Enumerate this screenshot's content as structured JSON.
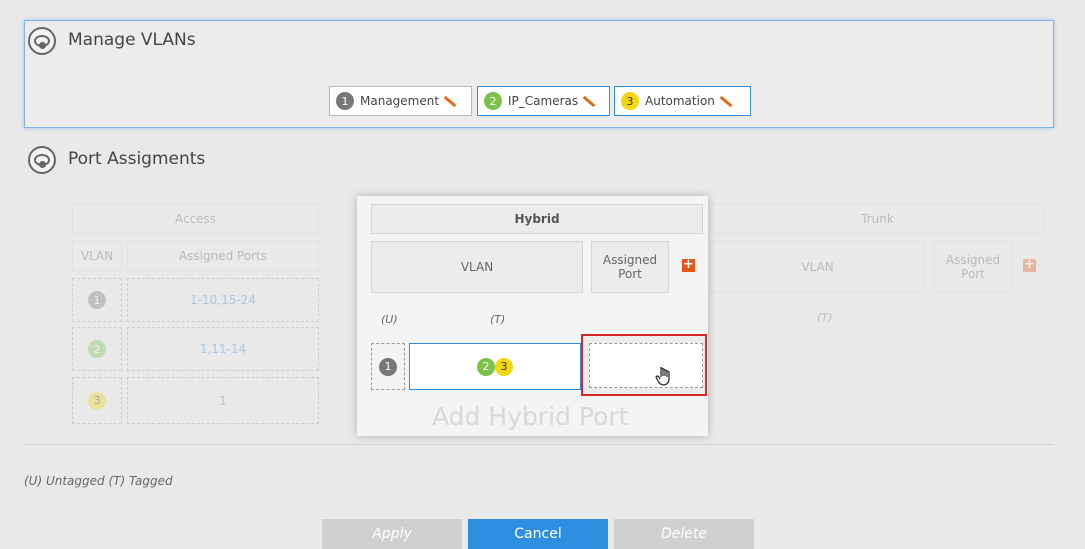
{
  "manage_vlans": {
    "title": "Manage VLANs",
    "vlans": [
      {
        "num": "1",
        "name": "Management",
        "color": "#777777"
      },
      {
        "num": "2",
        "name": "IP_Cameras",
        "color": "#7cc24a"
      },
      {
        "num": "3",
        "name": "Automation",
        "color": "#f5d60f"
      }
    ]
  },
  "port_assignments": {
    "title": "Port Assigments",
    "access": {
      "header": "Access",
      "col_vlan": "VLAN",
      "col_ports": "Assigned Ports",
      "rows": [
        {
          "vlan": "1",
          "ports": "1-10,15-24"
        },
        {
          "vlan": "2",
          "ports": "1,11-14"
        },
        {
          "vlan": "3",
          "ports": "1"
        }
      ]
    },
    "hybrid": {
      "header": "Hybrid",
      "col_vlan": "VLAN",
      "col_port": "Assigned Port",
      "untagged_label": "(U)",
      "tagged_label": "(T)",
      "row_untagged": "1",
      "row_tagged": [
        "2",
        "3"
      ],
      "placeholder": "Add Hybrid Port"
    },
    "trunk": {
      "header": "Trunk",
      "col_vlan": "VLAN",
      "col_port": "Assigned Port",
      "tagged_label": "(T)"
    }
  },
  "legend": "(U) Untagged (T) Tagged",
  "buttons": {
    "apply": "Apply",
    "cancel": "Cancel",
    "delete": "Delete"
  },
  "colors": {
    "accent": "#2e8fe0",
    "plus": "#e8561a",
    "highlight": "#d9262c"
  }
}
